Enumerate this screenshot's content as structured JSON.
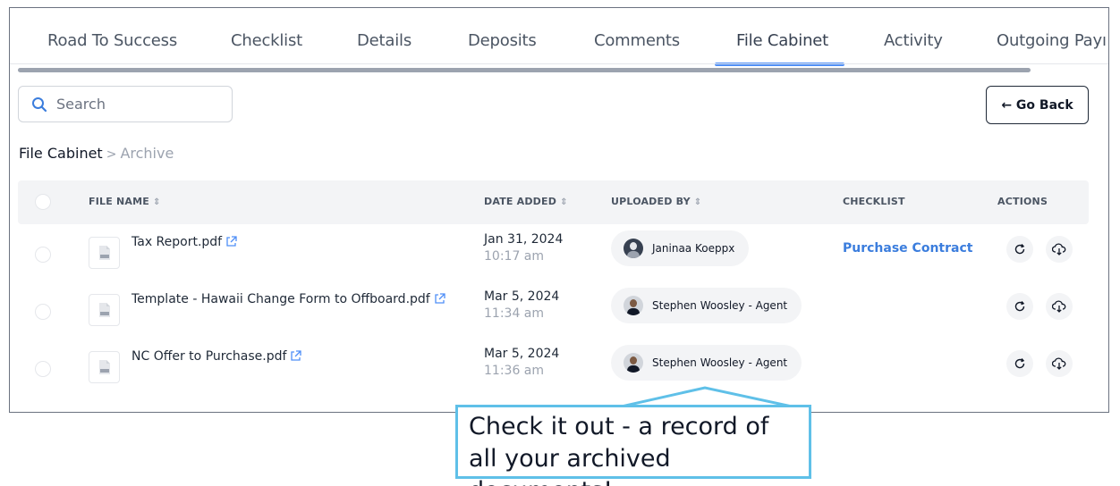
{
  "tabs": [
    {
      "label": "Road To Success"
    },
    {
      "label": "Checklist"
    },
    {
      "label": "Details"
    },
    {
      "label": "Deposits"
    },
    {
      "label": "Comments"
    },
    {
      "label": "File Cabinet",
      "active": true
    },
    {
      "label": "Activity"
    },
    {
      "label": "Outgoing Payı"
    }
  ],
  "search": {
    "placeholder": "Search"
  },
  "go_back": {
    "label": "← Go Back"
  },
  "breadcrumb": {
    "root": "File Cabinet",
    "separator": ">",
    "current": "Archive"
  },
  "table": {
    "columns": {
      "file_name": "FILE NAME",
      "date_added": "DATE ADDED",
      "uploaded_by": "UPLOADED BY",
      "checklist": "CHECKLIST",
      "actions": "ACTIONS"
    },
    "sort_icon": "⇕",
    "rows": [
      {
        "file_name": "Tax Report.pdf",
        "date": "Jan 31, 2024",
        "time": "10:17 am",
        "uploaded_by": "Janinaa Koeppx",
        "checklist": "Purchase Contract"
      },
      {
        "file_name": "Template - Hawaii Change Form to Offboard.pdf",
        "date": "Mar 5, 2024",
        "time": "11:34 am",
        "uploaded_by": "Stephen Woosley - Agent",
        "checklist": ""
      },
      {
        "file_name": "NC Offer to Purchase.pdf",
        "date": "Mar 5, 2024",
        "time": "11:36 am",
        "uploaded_by": "Stephen Woosley - Agent",
        "checklist": ""
      }
    ]
  },
  "callout": {
    "text": "Check it out - a record of all your archived documents!"
  },
  "colors": {
    "accent": "#4f8ff7",
    "link": "#3b7ddd",
    "callout_border": "#5fc0e8"
  },
  "icons": [
    "search-icon",
    "external-link-icon",
    "pdf-file-icon",
    "restore-icon",
    "download-icon"
  ]
}
